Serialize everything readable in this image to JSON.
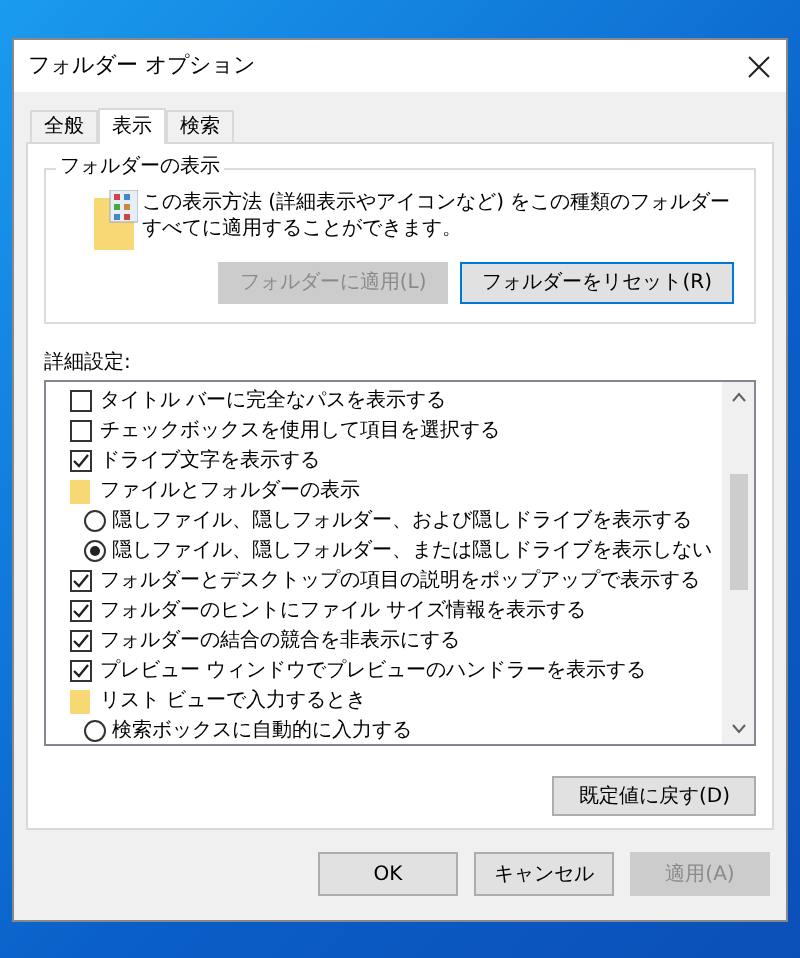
{
  "window": {
    "title": "フォルダー オプション"
  },
  "tabs": [
    {
      "label": "全般",
      "selected": false
    },
    {
      "label": "表示",
      "selected": true
    },
    {
      "label": "検索",
      "selected": false
    }
  ],
  "folder_views": {
    "title": "フォルダーの表示",
    "description": "この表示方法 (詳細表示やアイコンなど) をこの種類のフォルダーすべてに適用することができます。",
    "buttons": [
      {
        "label": "フォルダーに適用(L)",
        "disabled": true,
        "default": false
      },
      {
        "label": "フォルダーをリセット(R)",
        "disabled": false,
        "default": true
      }
    ]
  },
  "advanced": {
    "label": "詳細設定:",
    "items": [
      {
        "kind": "checkbox",
        "label": "タイトル バーに完全なパスを表示する",
        "checked": false
      },
      {
        "kind": "checkbox",
        "label": "チェックボックスを使用して項目を選択する",
        "checked": false
      },
      {
        "kind": "checkbox",
        "label": "ドライブ文字を表示する",
        "checked": true
      },
      {
        "kind": "folder",
        "label": "ファイルとフォルダーの表示"
      },
      {
        "kind": "radio",
        "label": "隠しファイル、隠しフォルダー、および隠しドライブを表示する",
        "selected": false
      },
      {
        "kind": "radio",
        "label": "隠しファイル、隠しフォルダー、または隠しドライブを表示しない",
        "selected": true
      },
      {
        "kind": "checkbox",
        "label": "フォルダーとデスクトップの項目の説明をポップアップで表示する",
        "checked": true
      },
      {
        "kind": "checkbox",
        "label": "フォルダーのヒントにファイル サイズ情報を表示する",
        "checked": true
      },
      {
        "kind": "checkbox",
        "label": "フォルダーの結合の競合を非表示にする",
        "checked": true
      },
      {
        "kind": "checkbox",
        "label": "プレビュー ウィンドウでプレビューのハンドラーを表示する",
        "checked": true
      },
      {
        "kind": "folder",
        "label": "リスト ビューで入力するとき"
      },
      {
        "kind": "radio",
        "label": "検索ボックスに自動的に入力する",
        "selected": false
      }
    ]
  },
  "restore_button": "既定値に戻す(D)",
  "dialog_buttons": [
    {
      "label": "OK",
      "disabled": false
    },
    {
      "label": "キャンセル",
      "disabled": false
    },
    {
      "label": "適用(A)",
      "disabled": true
    }
  ]
}
